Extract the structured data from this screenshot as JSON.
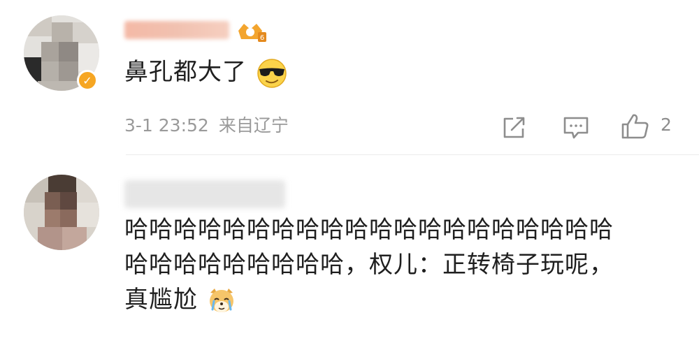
{
  "comments": [
    {
      "text": "鼻孔都大了",
      "emoji": "cool-sunglasses-emoji",
      "time": "3-1 23:52",
      "location": "来自辽宁",
      "likes": "2"
    },
    {
      "text_line1": "哈哈哈哈哈哈哈哈哈哈哈哈哈哈哈哈哈哈哈哈",
      "text_line2": "哈哈哈哈哈哈哈哈哈，权儿：正转椅子玩呢，",
      "text_line3": "真尴尬",
      "emoji": "crying-dog-emoji"
    }
  ],
  "colors": {
    "meta_text": "#9a9a9a",
    "verified_badge": "#f6a623",
    "divider": "#ececec"
  }
}
